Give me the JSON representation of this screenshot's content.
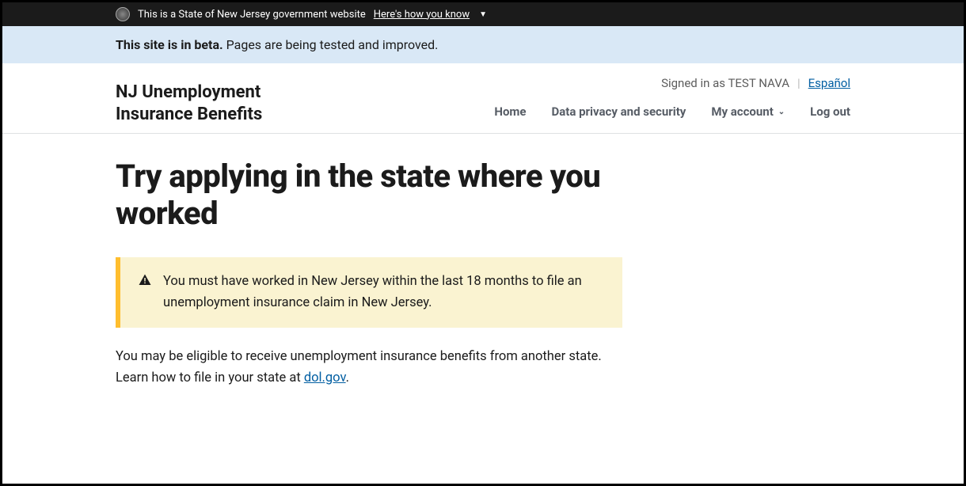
{
  "gov_banner": {
    "text": "This is a State of New Jersey government website",
    "link_text": "Here's how you know"
  },
  "beta": {
    "strong": "This site is in beta.",
    "rest": " Pages are being tested and improved."
  },
  "site_title": "NJ Unemployment Insurance Benefits",
  "header": {
    "signed_in_prefix": "Signed in as ",
    "user_name": "TEST NAVA",
    "language_link": "Español"
  },
  "nav": {
    "home": "Home",
    "privacy": "Data privacy and security",
    "account": "My account",
    "logout": "Log out"
  },
  "page": {
    "title": "Try applying in the state where you worked",
    "alert_text": "You must have worked in New Jersey within the last 18 months to file an unemployment insurance claim in New Jersey.",
    "body_before": "You may be eligible to receive unemployment insurance benefits from another state. Learn how to file in your state at ",
    "body_link_text": "dol.gov",
    "body_after": "."
  }
}
